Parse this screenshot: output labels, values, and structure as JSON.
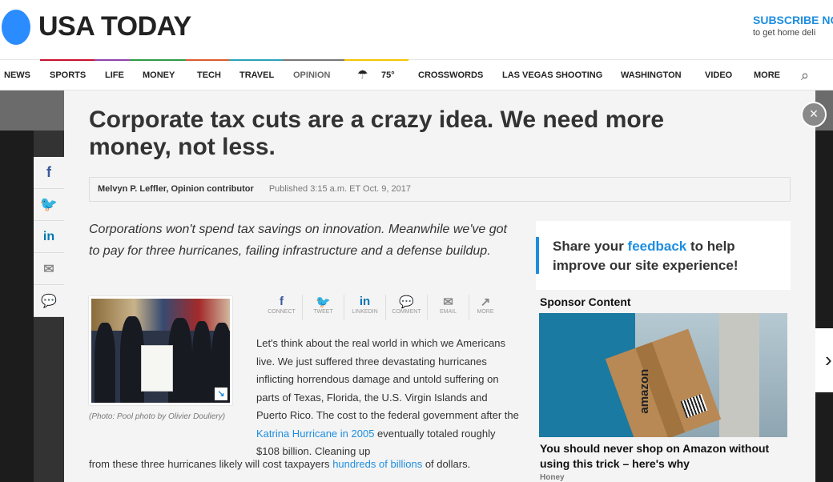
{
  "header": {
    "logo": "USA TODAY",
    "subscribe": "SUBSCRIBE NO",
    "subscribe_sub": "to get home deli"
  },
  "nav": {
    "items": [
      "NEWS",
      "SPORTS",
      "LIFE",
      "MONEY",
      "TECH",
      "TRAVEL",
      "OPINION",
      "75°",
      "CROSSWORDS",
      "LAS VEGAS SHOOTING",
      "WASHINGTON",
      "VIDEO",
      "MORE"
    ],
    "active": "OPINION",
    "weather_icon": "rain-cloud-icon",
    "colors": {
      "sports": "#c8102e",
      "life": "#8e44ad",
      "money": "#2e9a46",
      "tech": "#dc5b2f",
      "travel": "#2aa3b8",
      "opinion": "#777777",
      "weather": "#f5c400"
    }
  },
  "article": {
    "title": "Corporate tax cuts are a crazy idea. We need more money, not less.",
    "author": "Melvyn P. Leffler, Opinion contributor",
    "published": "Published 3:15 a.m. ET Oct. 9, 2017",
    "lead": "Corporations won't spend tax savings on innovation. Meanwhile we've got to pay for three hurricanes, failing infrastructure and a defense buildup.",
    "photo_caption": "(Photo: Pool photo by Olivier Douliery)",
    "share": [
      {
        "icon": "f",
        "label": "CONNECT"
      },
      {
        "icon": "🐦",
        "label": "TWEET"
      },
      {
        "icon": "in",
        "label": "LINKEDIN"
      },
      {
        "icon": "💬",
        "label": "COMMENT"
      },
      {
        "icon": "✉",
        "label": "EMAIL"
      },
      {
        "icon": "↗",
        "label": "MORE"
      }
    ],
    "body_1": "Let's think about the real world in which we Americans live. We just suffered three devastating hurricanes inflicting horrendous damage and untold suffering on parts of Texas, Florida, the U.S. Virgin Islands and Puerto Rico. The cost to the federal government after the ",
    "body_link_1": "Katrina Hurricane in 2005",
    "body_2": " eventually totaled roughly $108 billion. Cleaning up",
    "body_3": "from these three hurricanes likely will cost taxpayers ",
    "body_link_2": "hundreds of billions",
    "body_4": " of dollars."
  },
  "rail": {
    "items": [
      "facebook-icon",
      "twitter-icon",
      "linkedin-icon",
      "email-icon",
      "comment-icon"
    ]
  },
  "sidebar": {
    "feedback_pre": "Share your ",
    "feedback_link": "feedback",
    "feedback_post": " to help improve our site experience!",
    "sponsor_label": "Sponsor Content",
    "sponsor_brand": "amazon",
    "sponsor_title": "You should never shop on Amazon without using this trick – here's why",
    "sponsor_source": "Honey"
  }
}
